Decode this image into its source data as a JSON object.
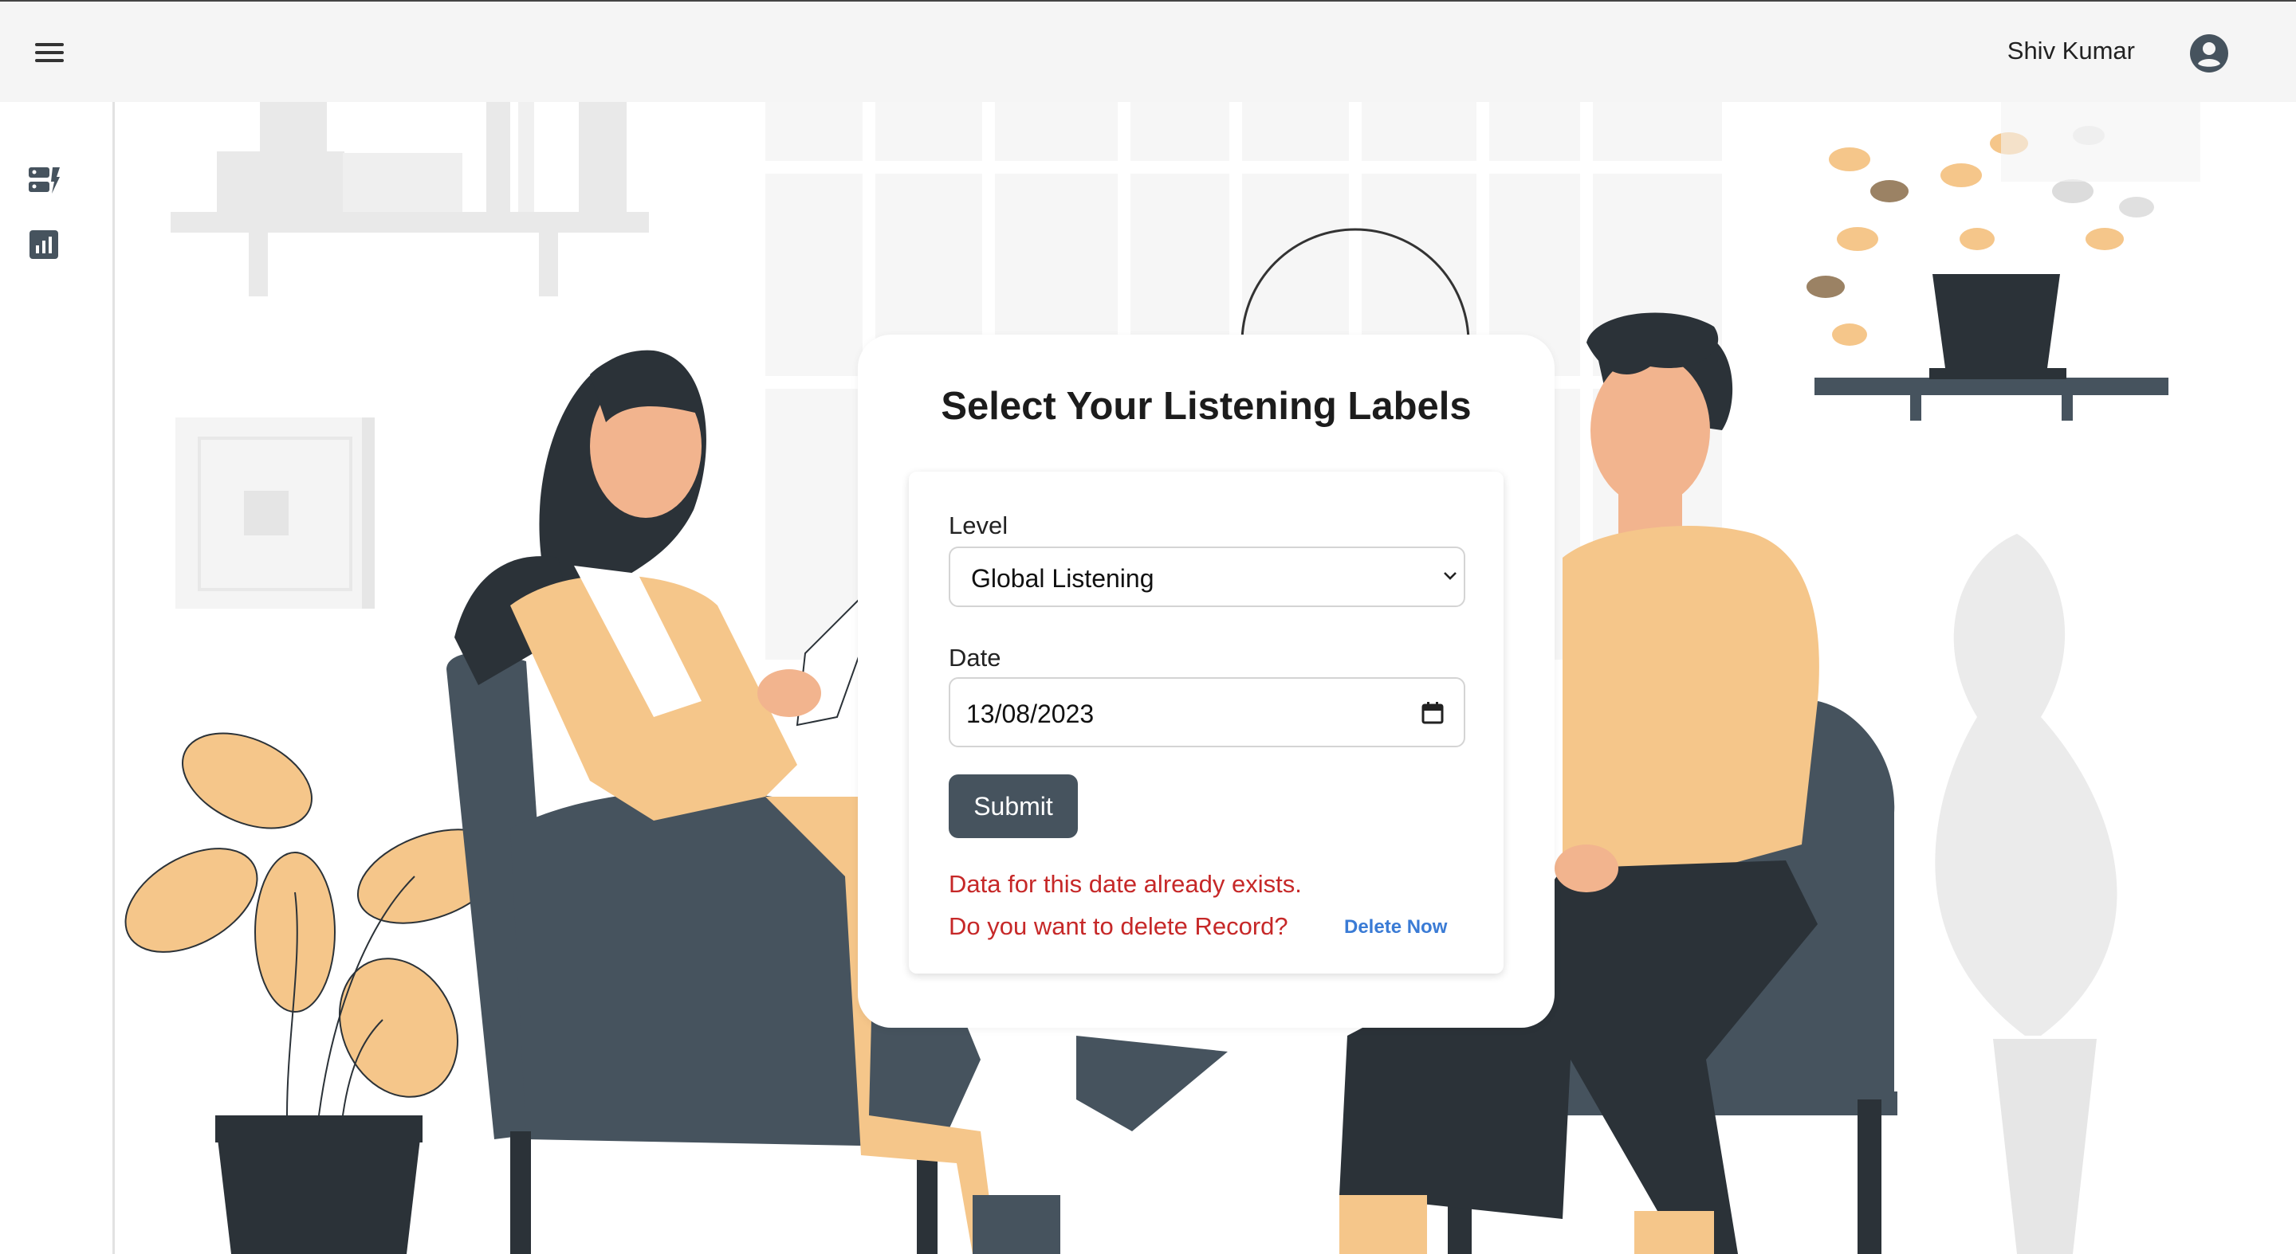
{
  "header": {
    "user_name": "Shiv Kumar"
  },
  "icons": {
    "menu": "menu-icon",
    "account": "account-circle-icon",
    "sidebar": [
      "dashboard-icon",
      "bar-chart-icon"
    ]
  },
  "form": {
    "title": "Select Your Listening Labels",
    "level_label": "Level",
    "level_value": "Global Listening",
    "date_label": "Date",
    "date_value": "13/08/2023",
    "submit_label": "Submit",
    "error_line1": "Data for this date already exists.",
    "error_line2": "Do you want to delete Record?",
    "delete_link": "Delete Now"
  },
  "colors": {
    "topbar": "#f5f5f5",
    "button": "#46535e",
    "error": "#c62828",
    "link": "#3a7bd5",
    "illustration_dark": "#46535e",
    "illustration_yellow": "#f5c68a"
  }
}
